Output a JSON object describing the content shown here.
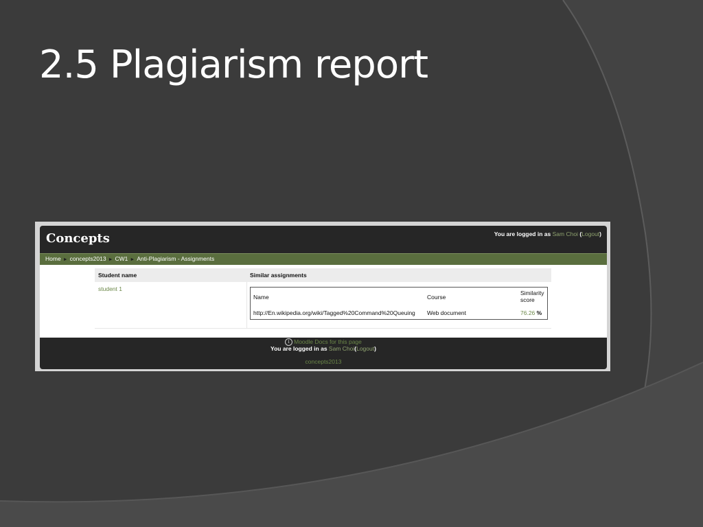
{
  "slide": {
    "title": "2.5 Plagiarism report"
  },
  "site": {
    "logo": "Concepts",
    "login_prefix": "You are logged in as",
    "user_name": "Sam Choi",
    "logout_label": "Logout",
    "open_paren": "(",
    "close_paren": ")"
  },
  "breadcrumb": {
    "items": [
      "Home",
      "concepts2013",
      "CW1",
      "Anti-Plagiarism - Assignments"
    ],
    "separator": "►"
  },
  "report": {
    "col_student": "Student name",
    "col_similar": "Similar assignments",
    "student": "student 1",
    "inner_headers": {
      "name": "Name",
      "course": "Course",
      "similarity_line1": "Similarity",
      "similarity_line2": "score"
    },
    "row": {
      "name": "http://En.wikipedia.org/wiki/Tagged%20Command%20Queuing",
      "course": "Web document",
      "score": "76.26",
      "unit": "%"
    }
  },
  "footer": {
    "docs_label": "Moodle Docs for this page",
    "info_glyph": "i",
    "login_prefix": "You are logged in as",
    "user_name": "Sam Choi",
    "logout_label": "Logout",
    "course_link": "concepts2013"
  },
  "colors": {
    "slide_bg": "#3b3b3b",
    "moodle_header": "#262626",
    "nav_green": "#5a6e3e",
    "link_green": "#6b8748"
  },
  "icons": {
    "info": "info-icon",
    "breadcrumb_separator": "triangle-right-icon"
  }
}
